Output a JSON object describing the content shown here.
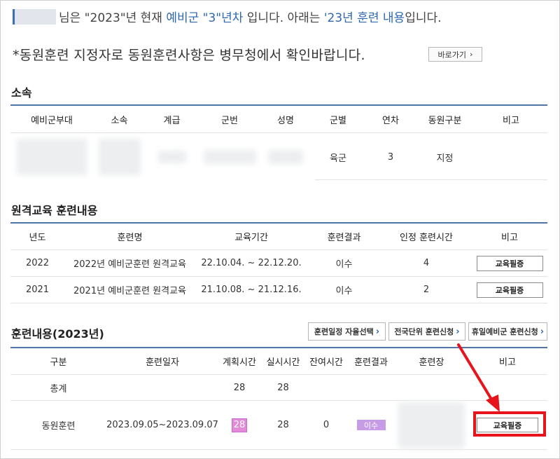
{
  "intro": {
    "t1": "님은 \"2023\"년 현재 ",
    "t2": "예비군 \"3\"년차",
    "t3": " 입니다. 아래는 ",
    "t4": "'23년 훈련 내용",
    "t5": "입니다.",
    "notice": "*동원훈련 지정자로 동원훈련사항은 병무청에서 확인바랍니다.",
    "shortcut_label": "바로가기"
  },
  "affiliation": {
    "title": "소속",
    "headers": [
      "예비군부대",
      "소속",
      "계급",
      "군번",
      "성명",
      "군별",
      "연차",
      "동원구분",
      "비고"
    ],
    "row": {
      "branch": "육군",
      "year": "3",
      "mobilization": "지정",
      "note": ""
    }
  },
  "remote": {
    "title": "원격교육 훈련내용",
    "headers": [
      "년도",
      "훈련명",
      "교육기간",
      "훈련결과",
      "인정 훈련시간",
      "비고"
    ],
    "rows": [
      {
        "year": "2022",
        "name": "2022년 예비군훈련 원격교육",
        "period": "22.10.04. ~ 22.12.20.",
        "result": "이수",
        "hours": "4",
        "button": "교육필증"
      },
      {
        "year": "2021",
        "name": "2021년 예비군훈련 원격교육",
        "period": "21.10.08. ~ 21.12.16.",
        "result": "이수",
        "hours": "2",
        "button": "교육필증"
      }
    ]
  },
  "training": {
    "title": "훈련내용(2023년)",
    "links": [
      "훈련일정 자율선택",
      "전국단위 훈련신청",
      "휴일예비군 훈련신청"
    ],
    "headers": [
      "구분",
      "훈련일자",
      "계획시간",
      "실시시간",
      "잔여시간",
      "훈련결과",
      "훈련장",
      "비고"
    ],
    "total": {
      "label": "총계",
      "planned": "28",
      "actual": "28"
    },
    "row": {
      "type": "동원훈련",
      "dates": "2023.09.05~2023.09.07",
      "planned": "28",
      "actual": "28",
      "remaining": "0",
      "result": "이수",
      "button": "교육필증"
    }
  },
  "colors": {
    "accent": "#2d68b0",
    "table_top": "#4f74a8",
    "highlight_red": "#e8141c",
    "pink_badge": "#e38ad8",
    "purple_badge": "#c79be5"
  }
}
